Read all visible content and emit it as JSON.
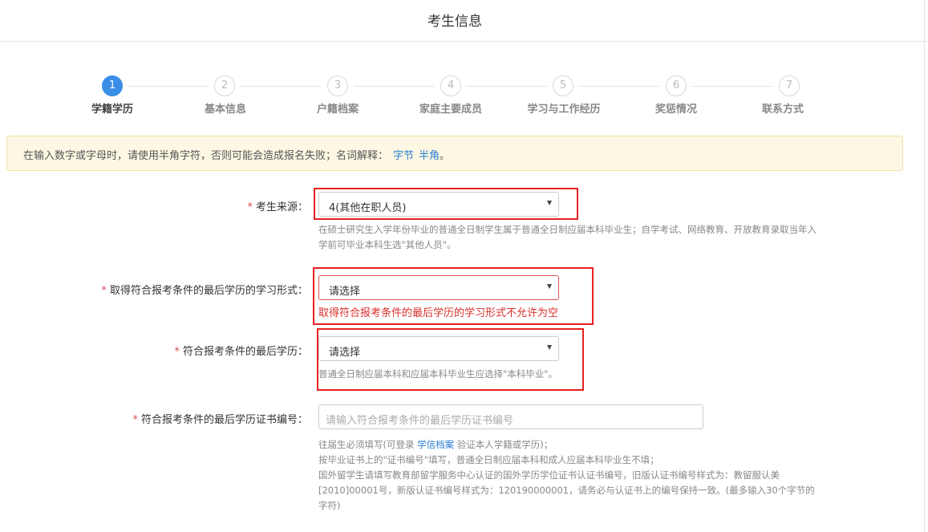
{
  "header": {
    "title": "考生信息"
  },
  "steps": [
    {
      "num": "1",
      "label": "学籍学历"
    },
    {
      "num": "2",
      "label": "基本信息"
    },
    {
      "num": "3",
      "label": "户籍档案"
    },
    {
      "num": "4",
      "label": "家庭主要成员"
    },
    {
      "num": "5",
      "label": "学习与工作经历"
    },
    {
      "num": "6",
      "label": "奖惩情况"
    },
    {
      "num": "7",
      "label": "联系方式"
    }
  ],
  "notice": {
    "text": "在输入数字或字母时，请使用半角字符，否则可能会造成报名失败；名词解释：",
    "link1": "字节",
    "link2": "半角",
    "end": "。"
  },
  "form": {
    "required_mark": "*",
    "source": {
      "label": "考生来源：",
      "value": "4(其他在职人员)",
      "help": "在硕士研究生入学年份毕业的普通全日制学生属于普通全日制应届本科毕业生；自学考试、网络教育、开放教育录取当年入学前可毕业本科生选\"其他人员\"。"
    },
    "study_form": {
      "label": "取得符合报考条件的最后学历的学习形式：",
      "value": "请选择",
      "error": "取得符合报考条件的最后学历的学习形式不允许为空"
    },
    "last_degree": {
      "label": "符合报考条件的最后学历：",
      "value": "请选择",
      "help": "普通全日制应届本科和应届本科毕业生应选择\"本科毕业\"。"
    },
    "cert_no": {
      "label": "符合报考条件的最后学历证书编号：",
      "placeholder": "请输入符合报考条件的最后学历证书编号",
      "help1_pre": "往届生必须填写(可登录 ",
      "help1_link": "学信档案",
      "help1_post": " 验证本人学籍或学历)；",
      "help2": "按毕业证书上的\"证书编号\"填写，普通全日制应届本科和成人应届本科毕业生不填；",
      "help3": "国外留学生请填写教育部留学服务中心认证的国外学历学位证书认证书编号，旧版认证书编号样式为：教留服认美[2010]00001号，新版认证书编号样式为：120190000001，请务必与认证书上的编号保持一致。(最多输入30个字节的字符)"
    }
  }
}
